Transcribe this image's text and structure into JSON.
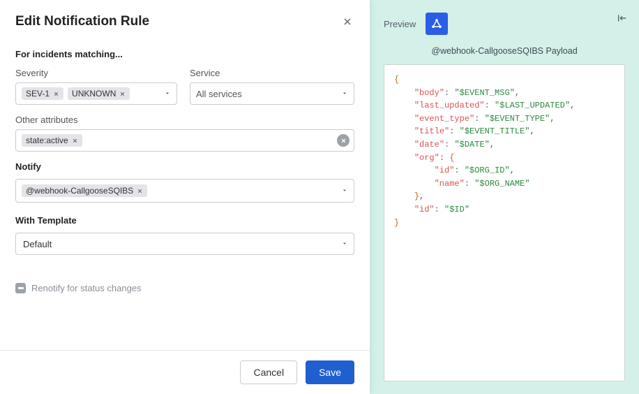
{
  "modal": {
    "title": "Edit Notification Rule",
    "matching_heading": "For incidents matching...",
    "severity": {
      "label": "Severity",
      "chips": [
        "SEV-1",
        "UNKNOWN"
      ]
    },
    "service": {
      "label": "Service",
      "placeholder": "All services"
    },
    "other_attributes": {
      "label": "Other attributes",
      "chips": [
        "state:active"
      ]
    },
    "notify": {
      "label": "Notify",
      "chips": [
        "@webhook-CallgooseSQIBS"
      ]
    },
    "template": {
      "label": "With Template",
      "value": "Default"
    },
    "renotify_label": "Renotify for status changes",
    "buttons": {
      "cancel": "Cancel",
      "save": "Save"
    }
  },
  "preview": {
    "label": "Preview",
    "payload_title": "@webhook-CallgooseSQIBS Payload",
    "json_lines": [
      {
        "indent": 0,
        "brace": "{"
      },
      {
        "indent": 1,
        "key": "body",
        "value": "$EVENT_MSG",
        "comma": true
      },
      {
        "indent": 1,
        "key": "last_updated",
        "value": "$LAST_UPDATED",
        "comma": true
      },
      {
        "indent": 1,
        "key": "event_type",
        "value": "$EVENT_TYPE",
        "comma": true
      },
      {
        "indent": 1,
        "key": "title",
        "value": "$EVENT_TITLE",
        "comma": true
      },
      {
        "indent": 1,
        "key": "date",
        "value": "$DATE",
        "comma": true
      },
      {
        "indent": 1,
        "key": "org",
        "brace_open": true
      },
      {
        "indent": 2,
        "key": "id",
        "value": "$ORG_ID",
        "comma": true
      },
      {
        "indent": 2,
        "key": "name",
        "value": "$ORG_NAME"
      },
      {
        "indent": 1,
        "brace": "}",
        "comma": true
      },
      {
        "indent": 1,
        "key": "id",
        "value": "$ID"
      },
      {
        "indent": 0,
        "brace": "}"
      }
    ]
  }
}
